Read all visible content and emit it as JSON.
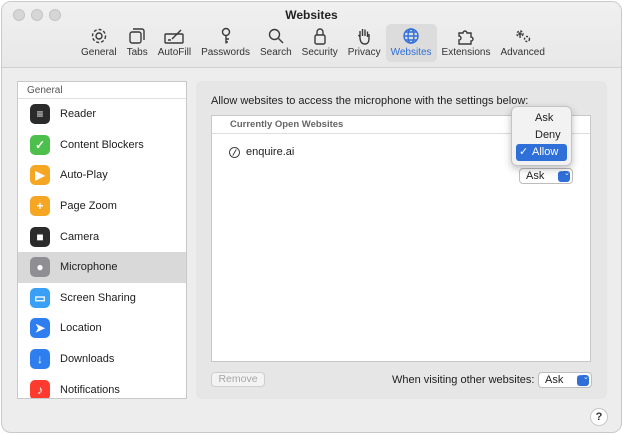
{
  "window": {
    "title": "Websites"
  },
  "toolbar": {
    "tabs": [
      {
        "label": "General",
        "icon": "gear-icon"
      },
      {
        "label": "Tabs",
        "icon": "tabs-icon"
      },
      {
        "label": "AutoFill",
        "icon": "pencil-form-icon"
      },
      {
        "label": "Passwords",
        "icon": "key-icon"
      },
      {
        "label": "Search",
        "icon": "search-icon"
      },
      {
        "label": "Security",
        "icon": "lock-icon"
      },
      {
        "label": "Privacy",
        "icon": "hand-icon"
      },
      {
        "label": "Websites",
        "icon": "globe-icon",
        "active": true
      },
      {
        "label": "Extensions",
        "icon": "puzzle-icon"
      },
      {
        "label": "Advanced",
        "icon": "gears-icon"
      }
    ]
  },
  "sidebar": {
    "header": "General",
    "items": [
      {
        "label": "Reader",
        "icon": "reader-icon",
        "color": "#2b2b2b",
        "glyph": "≡"
      },
      {
        "label": "Content Blockers",
        "icon": "content-blockers-icon",
        "color": "#4cbf4c",
        "glyph": "✓"
      },
      {
        "label": "Auto-Play",
        "icon": "autoplay-icon",
        "color": "#f5a623",
        "glyph": "▶"
      },
      {
        "label": "Page Zoom",
        "icon": "zoom-icon",
        "color": "#f5a623",
        "glyph": "+"
      },
      {
        "label": "Camera",
        "icon": "camera-icon",
        "color": "#2b2b2b",
        "glyph": "■"
      },
      {
        "label": "Microphone",
        "icon": "microphone-icon",
        "color": "#8e8e93",
        "glyph": "●",
        "selected": true
      },
      {
        "label": "Screen Sharing",
        "icon": "screen-sharing-icon",
        "color": "#3aa0f5",
        "glyph": "▭"
      },
      {
        "label": "Location",
        "icon": "location-icon",
        "color": "#2f7ef0",
        "glyph": "➤"
      },
      {
        "label": "Downloads",
        "icon": "downloads-icon",
        "color": "#2f7ef0",
        "glyph": "↓"
      },
      {
        "label": "Notifications",
        "icon": "notifications-icon",
        "color": "#ff3b30",
        "glyph": "♪"
      }
    ]
  },
  "content": {
    "allow_text": "Allow websites to access the microphone with the settings below:",
    "table_header": "Currently Open Websites",
    "site": {
      "name": "enquire.ai",
      "setting": "Ask"
    },
    "dropdown_menu": {
      "options": [
        "Ask",
        "Deny",
        "Allow"
      ],
      "selected": "Allow",
      "checkmark": "✓"
    },
    "remove_label": "Remove",
    "other_label": "When visiting other websites:",
    "other_value": "Ask",
    "arrow_glyph": "⌃⌄",
    "help": "?"
  },
  "colors": {
    "accent": "#2f6fd8"
  }
}
